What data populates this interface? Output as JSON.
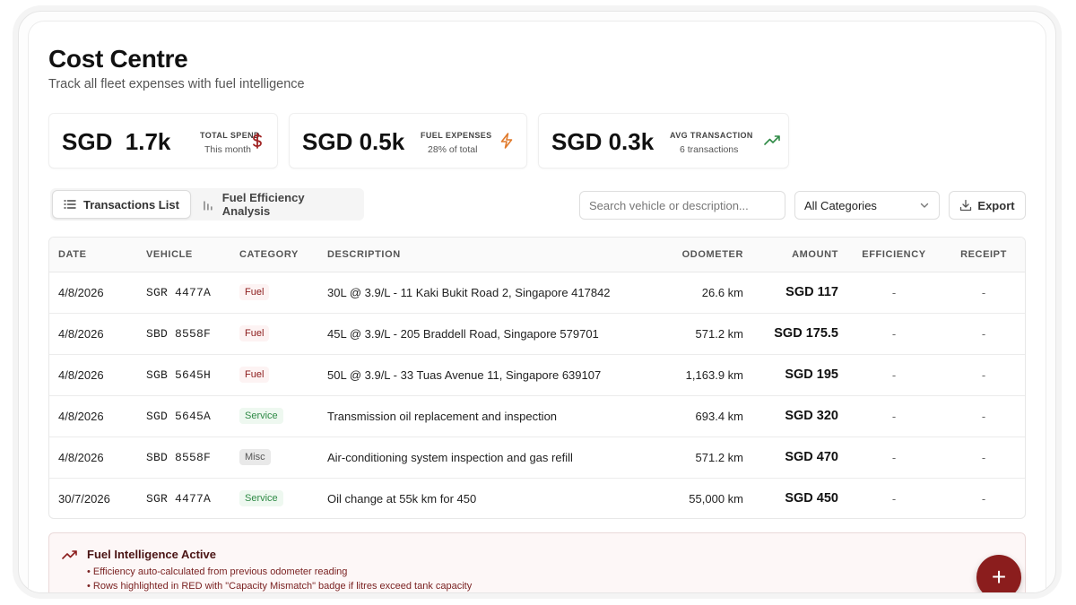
{
  "header": {
    "title": "Cost Centre",
    "subtitle": "Track all fleet expenses with fuel intelligence"
  },
  "stats": [
    {
      "value": "SGD  1.7k",
      "label": "TOTAL SPEND",
      "sub": "This month",
      "icon": "dollar-icon",
      "color": "#a12525"
    },
    {
      "value": "SGD 0.5k",
      "label": "FUEL EXPENSES",
      "sub": "28% of total",
      "icon": "lightning-icon",
      "color": "#e07a2c"
    },
    {
      "value": "SGD 0.3k",
      "label": "AVG TRANSACTION",
      "sub": "6 transactions",
      "icon": "trending-up-icon",
      "color": "#2f8a46"
    }
  ],
  "tabs": {
    "transactions": "Transactions List",
    "efficiency": "Fuel Efficiency Analysis"
  },
  "toolbar": {
    "search_placeholder": "Search vehicle or description...",
    "category_selected": "All Categories",
    "export_label": "Export"
  },
  "table": {
    "columns": [
      "DATE",
      "VEHICLE",
      "CATEGORY",
      "DESCRIPTION",
      "ODOMETER",
      "AMOUNT",
      "EFFICIENCY",
      "RECEIPT"
    ],
    "rows": [
      {
        "date": "4/8/2026",
        "vehicle": "SGR 4477A",
        "category": "Fuel",
        "cat_type": "fuel",
        "description": "30L @ 3.9/L - 11 Kaki Bukit Road 2, Singapore 417842",
        "odometer": "26.6 km",
        "amount": "SGD 117",
        "efficiency": "-",
        "receipt": "-"
      },
      {
        "date": "4/8/2026",
        "vehicle": "SBD 8558F",
        "category": "Fuel",
        "cat_type": "fuel",
        "description": "45L @ 3.9/L - 205 Braddell Road, Singapore 579701",
        "odometer": "571.2 km",
        "amount": "SGD 175.5",
        "efficiency": "-",
        "receipt": "-"
      },
      {
        "date": "4/8/2026",
        "vehicle": "SGB 5645H",
        "category": "Fuel",
        "cat_type": "fuel",
        "description": "50L @ 3.9/L - 33 Tuas Avenue 11, Singapore 639107",
        "odometer": "1,163.9 km",
        "amount": "SGD 195",
        "efficiency": "-",
        "receipt": "-"
      },
      {
        "date": "4/8/2026",
        "vehicle": "SGD 5645A",
        "category": "Service",
        "cat_type": "service",
        "description": "Transmission oil replacement and inspection",
        "odometer": "693.4 km",
        "amount": "SGD 320",
        "efficiency": "-",
        "receipt": "-"
      },
      {
        "date": "4/8/2026",
        "vehicle": "SBD 8558F",
        "category": "Misc",
        "cat_type": "misc",
        "description": "Air-conditioning system inspection and gas refill",
        "odometer": "571.2 km",
        "amount": "SGD 470",
        "efficiency": "-",
        "receipt": "-"
      },
      {
        "date": "30/7/2026",
        "vehicle": "SGR 4477A",
        "category": "Service",
        "cat_type": "service",
        "description": "Oil change at 55k km for 450",
        "odometer": "55,000 km",
        "amount": "SGD 450",
        "efficiency": "-",
        "receipt": "-"
      }
    ]
  },
  "info": {
    "title": "Fuel Intelligence Active",
    "lines": [
      "• Efficiency auto-calculated from previous odometer reading",
      "• Rows highlighted in RED with \"Capacity Mismatch\" badge if litres exceed tank capacity"
    ]
  },
  "fab_label": "+"
}
